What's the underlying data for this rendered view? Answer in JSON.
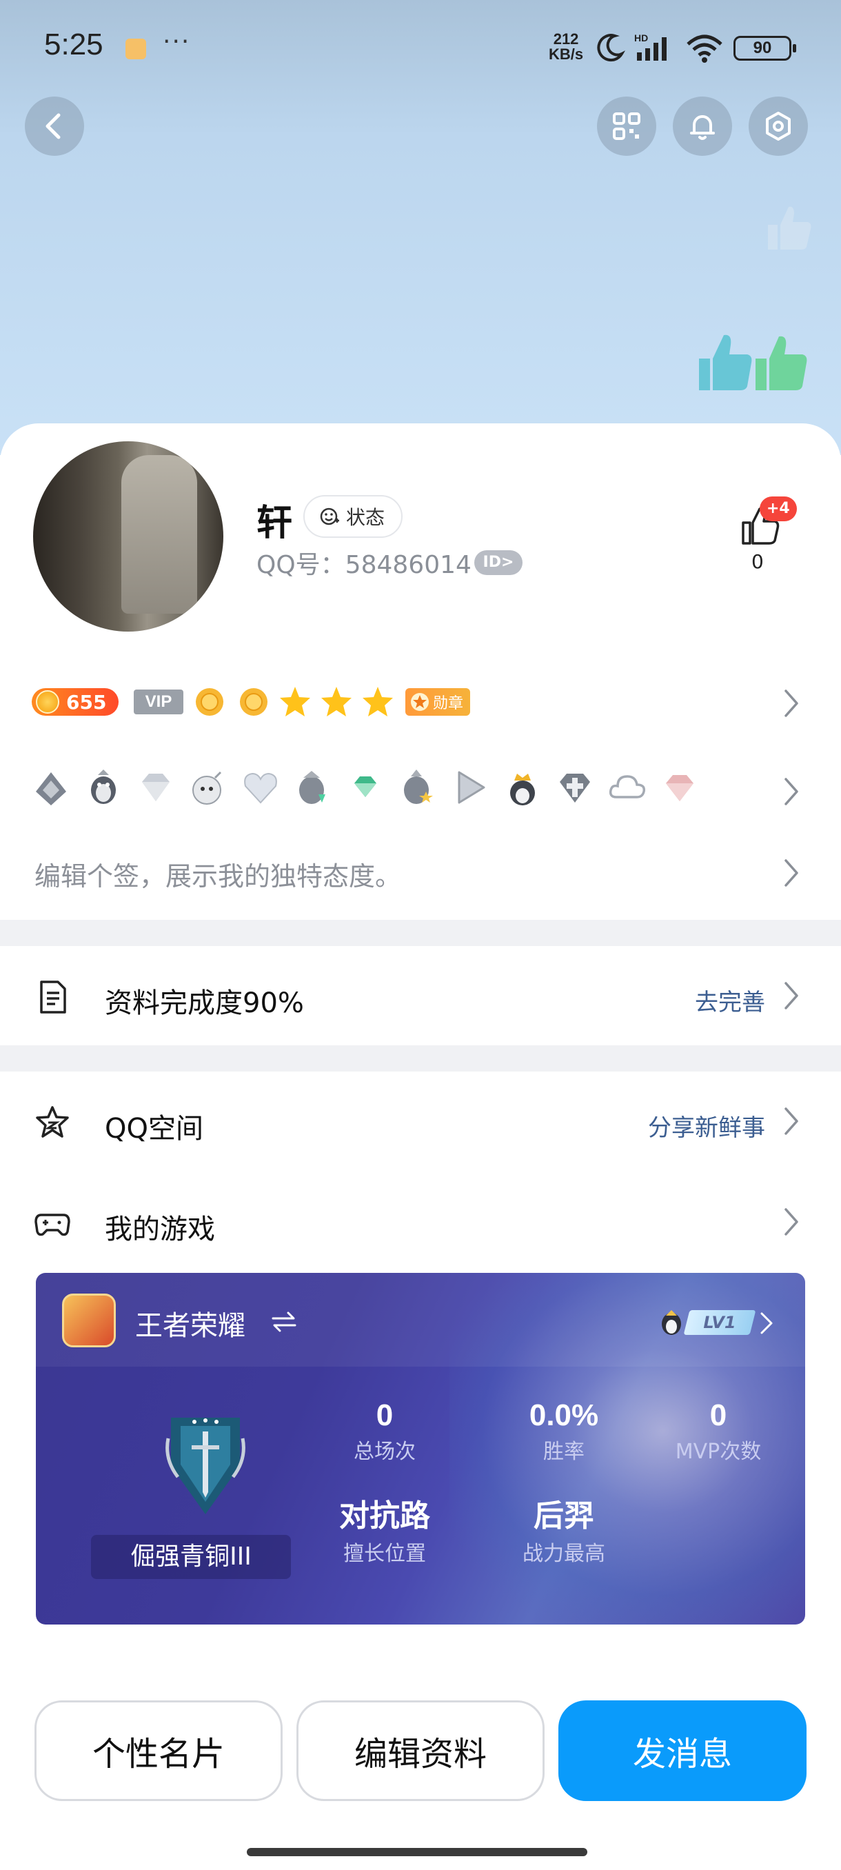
{
  "status_bar": {
    "time": "5:25",
    "more": "···",
    "speed_top": "212",
    "speed_bottom": "KB/s",
    "battery": "90"
  },
  "profile": {
    "nickname": "轩",
    "status_label": "状态",
    "qq_number": "QQ号：58486014",
    "id_badge": "ID>",
    "like_plus": "+4",
    "like_count": "0",
    "level": "655",
    "vip": "VIP",
    "medal_label": "勋章",
    "signature_placeholder": "编辑个签，展示我的独特态度。"
  },
  "list": {
    "completion_label": "资料完成度90%",
    "completion_action": "去完善",
    "qzone_label": "QQ空间",
    "qzone_action": "分享新鲜事",
    "games_label": "我的游戏"
  },
  "game": {
    "title": "王者荣耀",
    "level": "LV1",
    "rank_name": "倔强青铜III",
    "stats": {
      "matches_value": "0",
      "matches_label": "总场次",
      "winrate_value": "0.0%",
      "winrate_label": "胜率",
      "mvp_value": "0",
      "mvp_label": "MVP次数",
      "position_value": "对抗路",
      "position_label": "擅长位置",
      "hero_value": "后羿",
      "hero_label": "战力最高"
    }
  },
  "actions": {
    "card_button": "个性名片",
    "edit_button": "编辑资料",
    "message_button": "发消息"
  },
  "colors": {
    "primary": "#0a9bfb",
    "link": "#3c5e91",
    "badge_red": "#f5453b"
  }
}
